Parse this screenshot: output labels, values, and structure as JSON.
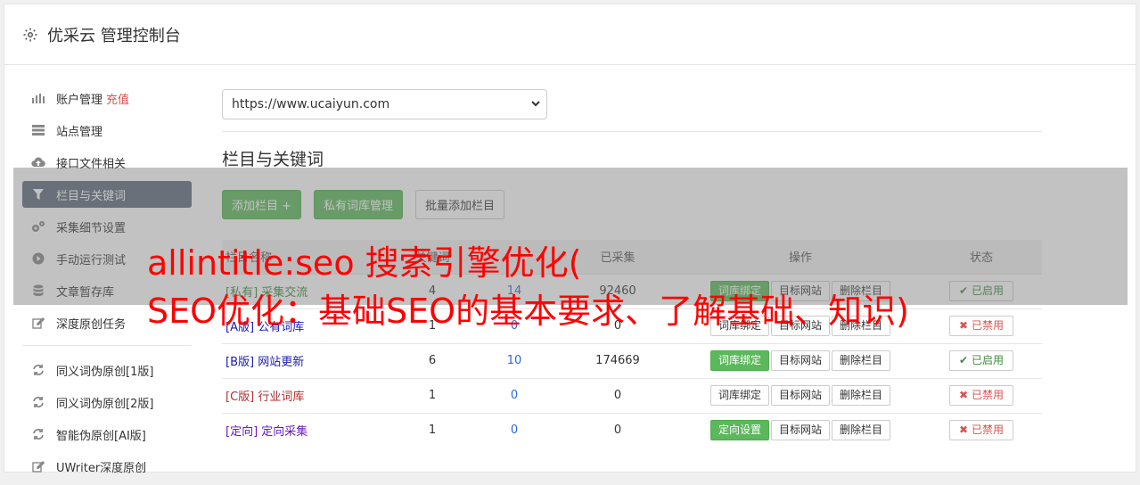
{
  "header": {
    "title": "优采云 管理控制台",
    "icon": "gear-icon"
  },
  "sidebar": {
    "items": [
      {
        "label": "账户管理",
        "extra": "充值",
        "icon": "bar-chart-icon"
      },
      {
        "label": "站点管理",
        "icon": "server-icon"
      },
      {
        "label": "接口文件相关",
        "icon": "cloud-upload-icon"
      },
      {
        "label": "栏目与关键词",
        "icon": "filter-icon",
        "active": true
      },
      {
        "label": "采集细节设置",
        "icon": "gears-icon"
      },
      {
        "label": "手动运行测试",
        "icon": "play-circle-icon"
      },
      {
        "label": "文章暂存库",
        "icon": "database-icon"
      },
      {
        "label": "深度原创任务",
        "icon": "edit-icon"
      }
    ],
    "items2": [
      {
        "label": "同义词伪原创[1版]",
        "icon": "refresh-icon"
      },
      {
        "label": "同义词伪原创[2版]",
        "icon": "refresh-icon"
      },
      {
        "label": "智能伪原创[AI版]",
        "icon": "refresh-icon"
      },
      {
        "label": "UWriter深度原创",
        "icon": "edit-icon"
      }
    ]
  },
  "main": {
    "site_select": "https://www.ucaiyun.com",
    "section_title": "栏目与关键词",
    "buttons": {
      "add": "添加栏目 +",
      "private": "私有词库管理",
      "batch": "批量添加栏目"
    },
    "table": {
      "headers": [
        "栏目名称",
        "关键词",
        "已采集",
        "操作",
        "状态"
      ],
      "rows": [
        {
          "tag": "[私有]",
          "name": "采集交流",
          "color": "green",
          "kw": "4",
          "col": "14",
          "total": "92460",
          "op1": "词库绑定",
          "op1_green": true,
          "op2": "目标网站",
          "op3": "删除栏目",
          "status": "已启用",
          "on": true
        },
        {
          "tag": "[A版]",
          "name": "公有词库",
          "color": "blue",
          "kw": "1",
          "col": "0",
          "total": "0",
          "op1": "词库绑定",
          "op1_green": false,
          "op2": "目标网站",
          "op3": "删除栏目",
          "status": "已禁用",
          "on": false
        },
        {
          "tag": "[B版]",
          "name": "网站更新",
          "color": "blue",
          "kw": "6",
          "col": "10",
          "total": "174669",
          "op1": "词库绑定",
          "op1_green": true,
          "op2": "目标网站",
          "op3": "删除栏目",
          "status": "已启用",
          "on": true
        },
        {
          "tag": "[C版]",
          "name": "行业词库",
          "color": "red",
          "kw": "1",
          "col": "0",
          "total": "0",
          "op1": "词库绑定",
          "op1_green": false,
          "op2": "目标网站",
          "op3": "删除栏目",
          "status": "已禁用",
          "on": false
        },
        {
          "tag": "[定向]",
          "name": "定向采集",
          "color": "purple",
          "kw": "1",
          "col": "0",
          "total": "0",
          "op1": "定向设置",
          "op1_green": true,
          "op2": "目标网站",
          "op3": "删除栏目",
          "status": "已禁用",
          "on": false
        }
      ]
    }
  },
  "overlay": {
    "line1": "allintitle:seo 搜索引擎优化(",
    "line2": "SEO优化：基础SEO的基本要求、了解基础、知识)"
  }
}
